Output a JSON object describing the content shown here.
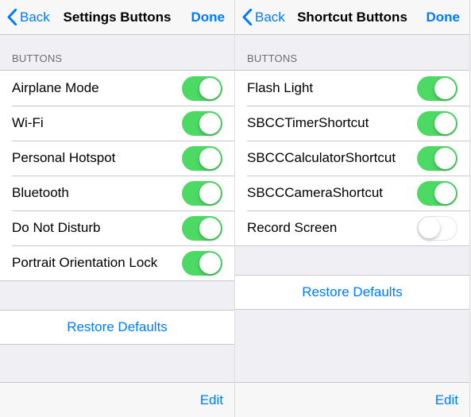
{
  "left": {
    "nav": {
      "back": "Back",
      "title": "Settings Buttons",
      "done": "Done"
    },
    "group_header": "Buttons",
    "rows": [
      {
        "label": "Airplane Mode",
        "on": true
      },
      {
        "label": "Wi-Fi",
        "on": true
      },
      {
        "label": "Personal Hotspot",
        "on": true
      },
      {
        "label": "Bluetooth",
        "on": true
      },
      {
        "label": "Do Not Disturb",
        "on": true
      },
      {
        "label": "Portrait Orientation Lock",
        "on": true
      }
    ],
    "restore": "Restore Defaults",
    "edit": "Edit"
  },
  "right": {
    "nav": {
      "back": "Back",
      "title": "Shortcut Buttons",
      "done": "Done"
    },
    "group_header": "Buttons",
    "rows": [
      {
        "label": "Flash Light",
        "on": true
      },
      {
        "label": "SBCCTimerShortcut",
        "on": true
      },
      {
        "label": "SBCCCalculatorShortcut",
        "on": true
      },
      {
        "label": "SBCCCameraShortcut",
        "on": true
      },
      {
        "label": "Record Screen",
        "on": false
      }
    ],
    "restore": "Restore Defaults",
    "edit": "Edit"
  }
}
